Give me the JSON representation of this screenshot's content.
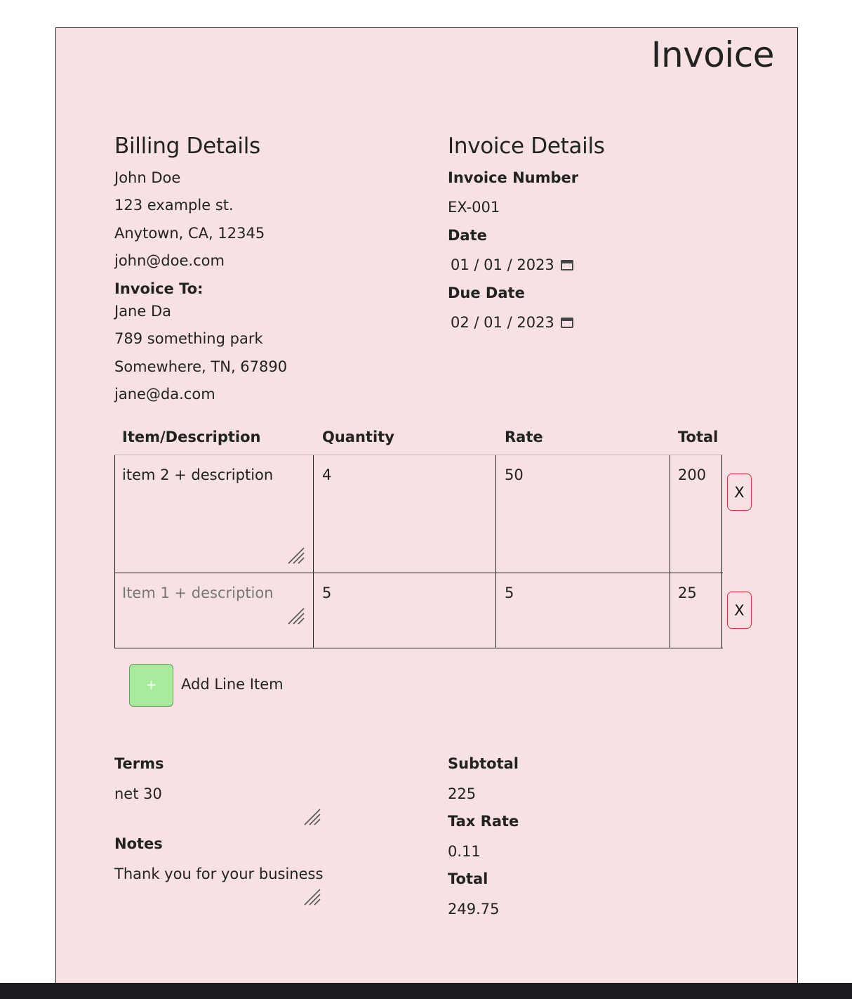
{
  "title": "Invoice",
  "billing": {
    "heading": "Billing Details",
    "from": {
      "name": "John Doe",
      "street": "123 example st.",
      "city": "Anytown, CA, 12345",
      "email": "john@doe.com"
    },
    "to_label": "Invoice To:",
    "to": {
      "name": "Jane Da",
      "street": "789 something park",
      "city": "Somewhere, TN, 67890",
      "email": "jane@da.com"
    }
  },
  "invoice": {
    "heading": "Invoice Details",
    "number_label": "Invoice Number",
    "number": "EX-001",
    "date_label": "Date",
    "date": {
      "mm": "01",
      "dd": "01",
      "yyyy": "2023"
    },
    "due_label": "Due Date",
    "due": {
      "mm": "02",
      "dd": "01",
      "yyyy": "2023"
    }
  },
  "table": {
    "headers": [
      "Item/Description",
      "Quantity",
      "Rate",
      "Total"
    ],
    "rows": [
      {
        "description": "item 2 + description",
        "quantity": "4",
        "rate": "50",
        "total": "200",
        "delete": "X"
      },
      {
        "description": "",
        "description_placeholder": "Item 1 + description",
        "quantity": "5",
        "rate": "5",
        "total": "25",
        "delete": "X"
      }
    ]
  },
  "add_item": {
    "icon": "+",
    "label": "Add Line Item"
  },
  "terms": {
    "label": "Terms",
    "value": "net 30"
  },
  "notes": {
    "label": "Notes",
    "value": "Thank you for your business"
  },
  "summary": {
    "subtotal_label": "Subtotal",
    "subtotal": "225",
    "tax_label": "Tax Rate",
    "tax": "0.11",
    "total_label": "Total",
    "total": "249.75"
  },
  "colors": {
    "paper": "#f8e1e3",
    "add_button": "#a8eb9c",
    "delete_border": "#d9333a"
  }
}
